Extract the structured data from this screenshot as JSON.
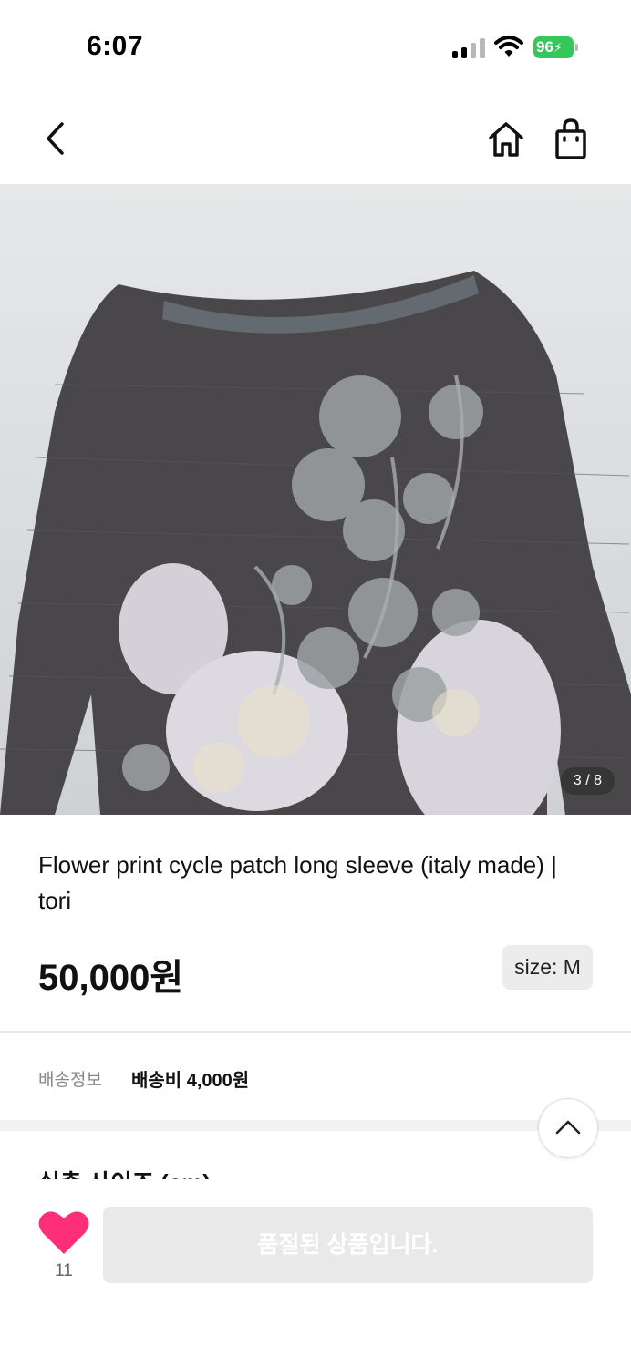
{
  "status_bar": {
    "time": "6:07",
    "battery": "96"
  },
  "product": {
    "image_counter": "3 / 8",
    "title": "Flower print cycle patch long sleeve (italy made) | tori",
    "price": "50,000원",
    "size": "size: M"
  },
  "shipping": {
    "label": "배송정보",
    "value": "배송비 4,000원"
  },
  "next_section_heading": "실측 사이즈 (cm)",
  "bottom_bar": {
    "like_count": "11",
    "soldout_label": "품절된 상품입니다."
  },
  "colors": {
    "like": "#ff2e78",
    "battery": "#34c759",
    "soldout_bg": "#e9e9e9"
  }
}
